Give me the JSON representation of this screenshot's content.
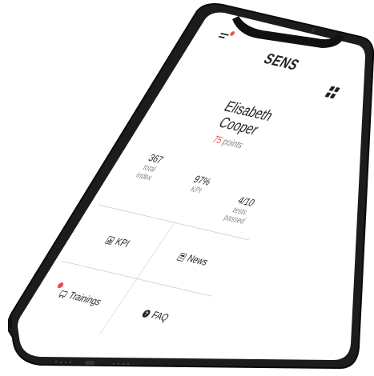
{
  "app": {
    "brand": "SENS",
    "accent_color": "#ef4b4b"
  },
  "header": {
    "menu_icon": "hamburger-menu-icon",
    "grid_icon": "grid-icon",
    "menu_has_notification": true
  },
  "profile": {
    "first_name": "Elisabeth",
    "last_name": "Cooper",
    "points_value": "75",
    "points_label": "points"
  },
  "stats": [
    {
      "value": "367",
      "label_line1": "total",
      "label_line2": "index"
    },
    {
      "value": "97%",
      "label_line1": "KPI",
      "label_line2": ""
    },
    {
      "value": "4/10",
      "label_line1": "tests",
      "label_line2": "passed"
    }
  ],
  "tiles": {
    "kpi": {
      "label": "KPI",
      "icon": "chart-icon"
    },
    "news": {
      "label": "News",
      "icon": "newspaper-icon"
    },
    "trainings": {
      "label": "Trainings",
      "icon": "training-icon",
      "has_notification": true
    },
    "faq": {
      "label": "FAQ",
      "icon": "question-circle-icon"
    }
  }
}
